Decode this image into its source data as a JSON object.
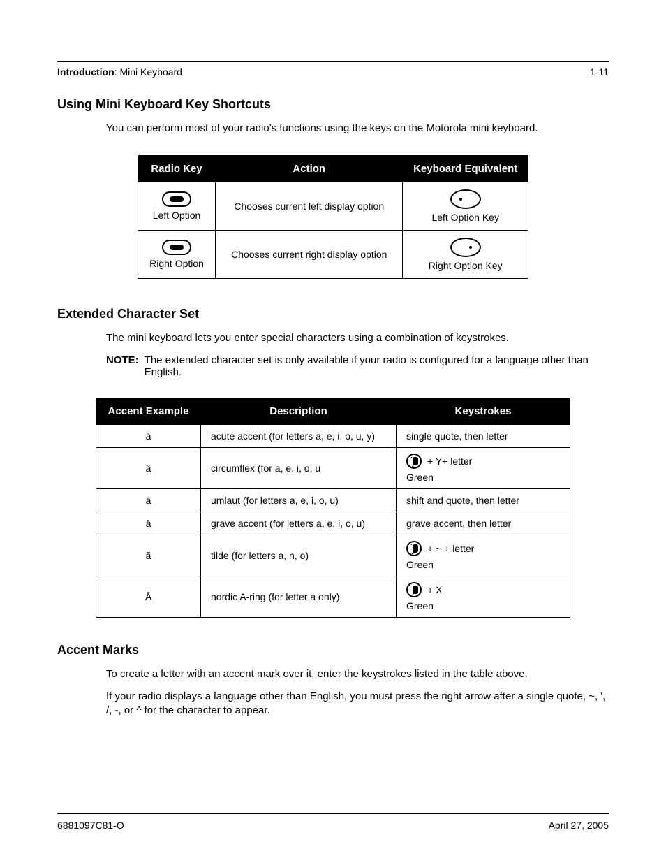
{
  "header": {
    "section": "Introduction",
    "subsection": "Mini Keyboard",
    "page_num": "1-11"
  },
  "sections": {
    "s1": {
      "title": "Using Mini Keyboard Key Shortcuts",
      "intro": "You can perform most of your radio's functions using the keys on the Motorola mini keyboard."
    },
    "s2": {
      "title": "Extended Character Set",
      "intro": "The mini keyboard lets you enter special characters using a combination of keystrokes.",
      "note_label": "NOTE:",
      "note_text": "The extended character set is only available if your radio is configured for a language other than English."
    },
    "s3": {
      "title": "Accent Marks",
      "p1": "To create a letter with an accent mark over it, enter the keystrokes listed in the table above.",
      "p2": "If your radio displays a language other than English, you must press the right arrow after a single quote, ~, ', /, -, or ^ for the character to appear."
    }
  },
  "table1": {
    "headers": [
      "Radio Key",
      "Action",
      "Keyboard Equivalent"
    ],
    "rows": [
      {
        "radio_label": "Left Option",
        "action": "Chooses current left display option",
        "equiv_label": "Left Option Key"
      },
      {
        "radio_label": "Right Option",
        "action": "Chooses current right display option",
        "equiv_label": "Right Option Key"
      }
    ]
  },
  "table2": {
    "headers": [
      "Accent Example",
      "Description",
      "Keystrokes"
    ],
    "green_label": "Green",
    "rows": [
      {
        "ex": "á",
        "desc": "acute accent (for letters a, e, i, o, u, y)",
        "key_plain": "single quote, then letter"
      },
      {
        "ex": "â",
        "desc": "circumflex (for a, e, i, o, u",
        "key_icon_suffix": " + Y+ letter"
      },
      {
        "ex": "ä",
        "desc": "umlaut (for letters a, e, i, o, u)",
        "key_plain": "shift and quote, then letter"
      },
      {
        "ex": "à",
        "desc": "grave accent (for letters a, e, i, o, u)",
        "key_plain": "grave accent, then letter"
      },
      {
        "ex": "ã",
        "desc": "tilde (for letters a, n, o)",
        "key_icon_suffix": " + ~ + letter"
      },
      {
        "ex": "Å",
        "desc": "nordic A-ring (for letter a only)",
        "key_icon_suffix": " + X"
      }
    ]
  },
  "footer": {
    "doc_id": "6881097C81-O",
    "date": "April 27, 2005"
  }
}
